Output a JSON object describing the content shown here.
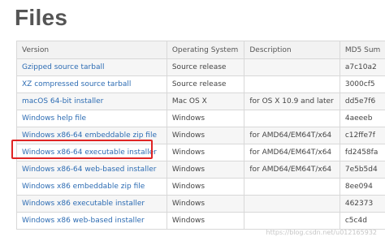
{
  "page": {
    "heading": "Files"
  },
  "table": {
    "headers": [
      "Version",
      "Operating System",
      "Description",
      "MD5 Sum"
    ],
    "rows": [
      {
        "version": "Gzipped source tarball",
        "os": "Source release",
        "description": "",
        "md5": "a7c10a2"
      },
      {
        "version": "XZ compressed source tarball",
        "os": "Source release",
        "description": "",
        "md5": "3000cf5"
      },
      {
        "version": "macOS 64-bit installer",
        "os": "Mac OS X",
        "description": "for OS X 10.9 and later",
        "md5": "dd5e7f6"
      },
      {
        "version": "Windows help file",
        "os": "Windows",
        "description": "",
        "md5": "4aeeeb"
      },
      {
        "version": "Windows x86-64 embeddable zip file",
        "os": "Windows",
        "description": "for AMD64/EM64T/x64",
        "md5": "c12ffe7f"
      },
      {
        "version": "Windows x86-64 executable installer",
        "os": "Windows",
        "description": "for AMD64/EM64T/x64",
        "md5": "fd2458fa"
      },
      {
        "version": "Windows x86-64 web-based installer",
        "os": "Windows",
        "description": "for AMD64/EM64T/x64",
        "md5": "7e5b5d4"
      },
      {
        "version": "Windows x86 embeddable zip file",
        "os": "Windows",
        "description": "",
        "md5": "8ee094"
      },
      {
        "version": "Windows x86 executable installer",
        "os": "Windows",
        "description": "",
        "md5": "462373"
      },
      {
        "version": "Windows x86 web-based installer",
        "os": "Windows",
        "description": "",
        "md5": "c5c4d"
      }
    ]
  },
  "highlighted_row": "Windows x86-64 executable installer",
  "watermark": "https://blog.csdn.net/u012165932"
}
